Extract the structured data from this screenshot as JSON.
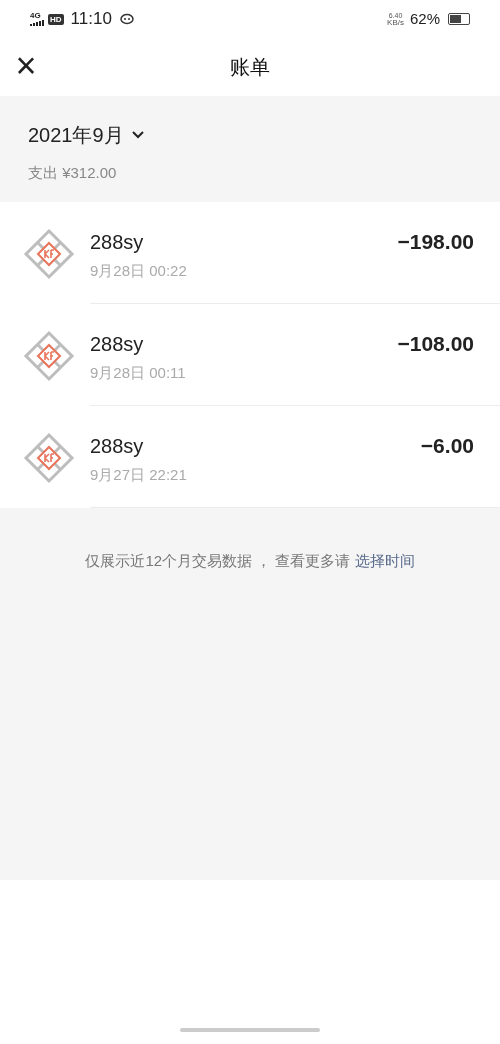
{
  "status_bar": {
    "network": "4G",
    "hd": "HD",
    "time": "11:10",
    "speed_value": "6.40",
    "speed_unit": "KB/s",
    "battery": "62%"
  },
  "header": {
    "close": "×",
    "title": "账单"
  },
  "period": {
    "month": "2021年9月",
    "summary": "支出 ¥312.00"
  },
  "transactions": [
    {
      "merchant": "288sy",
      "time": "9月28日 00:22",
      "amount": "−198.00"
    },
    {
      "merchant": "288sy",
      "time": "9月28日 00:11",
      "amount": "−108.00"
    },
    {
      "merchant": "288sy",
      "time": "9月27日 22:21",
      "amount": "−6.00"
    }
  ],
  "footer_note": {
    "text": "仅展示近12个月交易数据 ， 查看更多请",
    "link": "选择时间"
  }
}
